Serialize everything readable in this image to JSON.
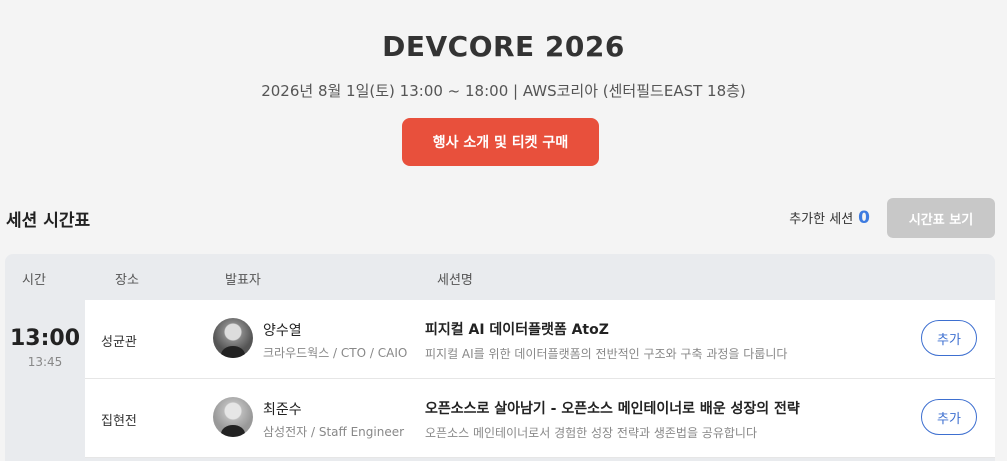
{
  "event": {
    "title": "DEVCORE 2026",
    "meta": "2026년 8월 1일(토) 13:00 ~ 18:00 | AWS코리아 (센터필드EAST 18층)",
    "cta_label": "행사 소개 및 티켓 구매"
  },
  "schedule": {
    "title": "세션 시간표",
    "added_label": "추가한 세션",
    "added_count": "0",
    "view_label": "시간표 보기",
    "headers": {
      "time": "시간",
      "venue": "장소",
      "speaker": "발표자",
      "session": "세션명"
    },
    "slot": {
      "start": "13:00",
      "end": "13:45"
    },
    "rows": [
      {
        "venue": "성균관",
        "speaker_name": "양수열",
        "speaker_role": "크라우드웍스 / CTO / CAIO",
        "session_title": "피지컬 AI 데이터플랫폼 AtoZ",
        "session_desc": "피지컬 AI를 위한 데이터플랫폼의 전반적인 구조와 구축 과정을 다룹니다",
        "add_label": "추가"
      },
      {
        "venue": "집현전",
        "speaker_name": "최준수",
        "speaker_role": "삼성전자 / Staff Engineer",
        "session_title": "오픈소스로 살아남기 - 오픈소스 메인테이너로 배운 성장의 전략",
        "session_desc": "오픈소스 메인테이너로서 경험한 성장 전략과 생존법을 공유합니다",
        "add_label": "추가"
      }
    ]
  },
  "colors": {
    "accent": "#e8503c",
    "link": "#3d6fd0",
    "count": "#3d7be0"
  }
}
